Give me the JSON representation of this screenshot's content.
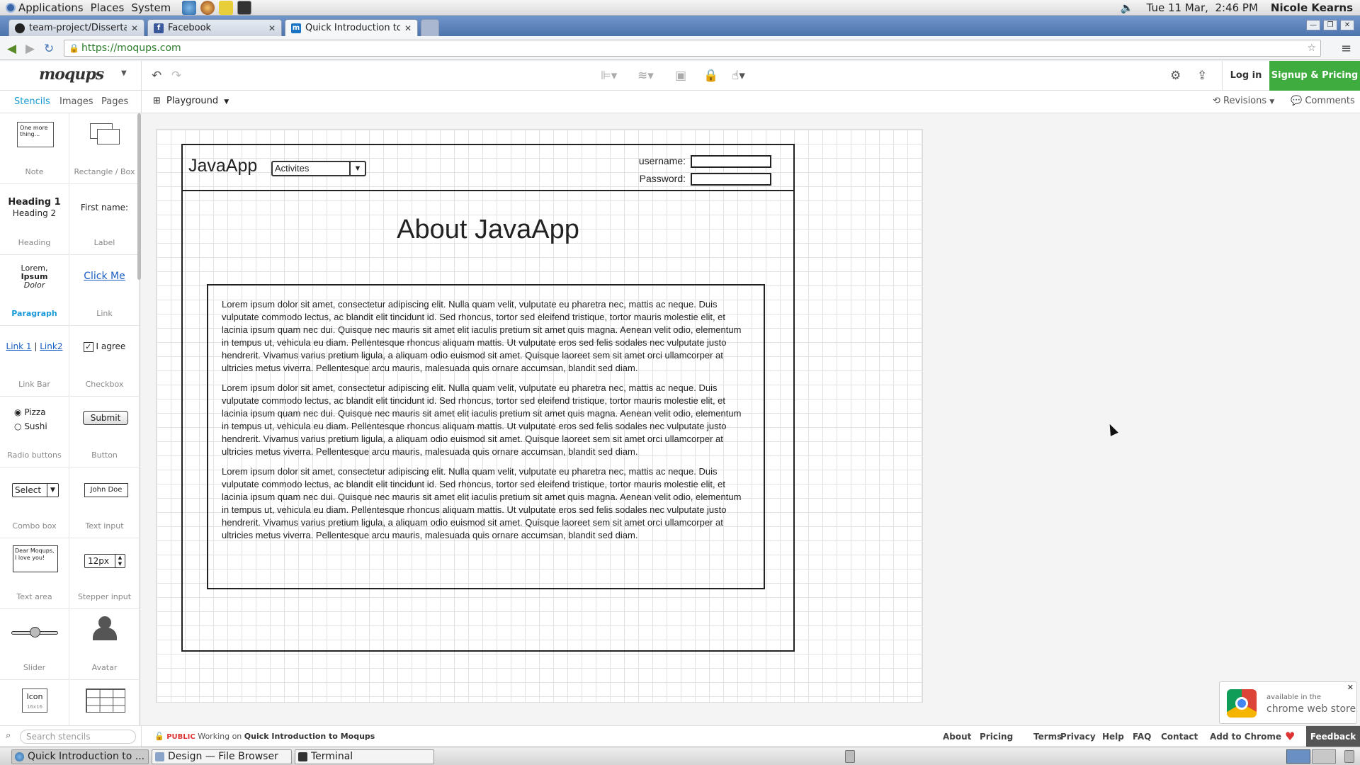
{
  "top_panel": {
    "menus": [
      "Applications",
      "Places",
      "System"
    ],
    "datetime": "Tue 11 Mar,  2:46 PM",
    "user": "Nicole Kearns"
  },
  "browser": {
    "tabs": [
      {
        "title": "team-project/Dissertatio",
        "icon": "github-icon"
      },
      {
        "title": "Facebook",
        "icon": "facebook-icon"
      },
      {
        "title": "Quick Introduction to M",
        "icon": "moqups-icon",
        "active": true
      }
    ],
    "url": "https://moqups.com"
  },
  "app": {
    "logo": "moqups",
    "login": "Log in",
    "signup": "Signup & Pricing",
    "side_tabs": [
      "Stencils",
      "Images",
      "Pages"
    ],
    "page_selector": "Playground",
    "revisions": "Revisions",
    "comments": "Comments"
  },
  "stencils": [
    {
      "label": "Note",
      "preview": "One more thing..."
    },
    {
      "label": "Rectangle / Box",
      "preview": ""
    },
    {
      "label": "Heading",
      "preview_h1": "Heading 1",
      "preview_h2": "Heading 2"
    },
    {
      "label": "Label",
      "preview": "First name:"
    },
    {
      "label": "Paragraph",
      "preview_1": "Lorem,",
      "preview_2": "Ipsum",
      "preview_3": "Dolor"
    },
    {
      "label": "Link",
      "preview": "Click Me"
    },
    {
      "label": "Link Bar",
      "preview_1": "Link 1",
      "preview_sep": "|",
      "preview_2": "Link2"
    },
    {
      "label": "Checkbox",
      "preview": "I agree"
    },
    {
      "label": "Radio buttons",
      "preview_1": "Pizza",
      "preview_2": "Sushi"
    },
    {
      "label": "Button",
      "preview": "Submit"
    },
    {
      "label": "Combo box",
      "preview": "Select"
    },
    {
      "label": "Text input",
      "preview": "John Doe"
    },
    {
      "label": "Text area",
      "preview": "Dear Moqups, I love you!"
    },
    {
      "label": "Stepper input",
      "preview": "12px"
    },
    {
      "label": "Slider",
      "preview": ""
    },
    {
      "label": "Avatar",
      "preview": ""
    },
    {
      "label": "",
      "preview": "Icon",
      "preview_sub": "16x16"
    },
    {
      "label": "",
      "preview": ""
    }
  ],
  "mockup": {
    "title": "JavaApp",
    "combo": "Activites",
    "username_label": "username:",
    "password_label": "Password:",
    "heading": "About JavaApp",
    "paragraphs": [
      "Lorem ipsum dolor sit amet, consectetur adipiscing elit. Nulla quam velit, vulputate eu pharetra nec, mattis ac neque. Duis vulputate commodo lectus, ac blandit elit tincidunt id. Sed rhoncus, tortor sed eleifend tristique, tortor mauris molestie elit, et lacinia ipsum quam nec dui. Quisque nec mauris sit amet elit iaculis pretium sit amet quis magna. Aenean velit odio, elementum in tempus ut, vehicula eu diam. Pellentesque rhoncus aliquam mattis. Ut vulputate eros sed felis sodales nec vulputate justo hendrerit. Vivamus varius pretium ligula, a aliquam odio euismod sit amet. Quisque laoreet sem sit amet orci ullamcorper at ultricies metus viverra. Pellentesque arcu mauris, malesuada quis ornare accumsan, blandit sed diam.",
      "Lorem ipsum dolor sit amet, consectetur adipiscing elit. Nulla quam velit, vulputate eu pharetra nec, mattis ac neque. Duis vulputate commodo lectus, ac blandit elit tincidunt id. Sed rhoncus, tortor sed eleifend tristique, tortor mauris molestie elit, et lacinia ipsum quam nec dui. Quisque nec mauris sit amet elit iaculis pretium sit amet quis magna. Aenean velit odio, elementum in tempus ut, vehicula eu diam. Pellentesque rhoncus aliquam mattis. Ut vulputate eros sed felis sodales nec vulputate justo hendrerit. Vivamus varius pretium ligula, a aliquam odio euismod sit amet. Quisque laoreet sem sit amet orci ullamcorper at ultricies metus viverra. Pellentesque arcu mauris, malesuada quis ornare accumsan, blandit sed diam.",
      "Lorem ipsum dolor sit amet, consectetur adipiscing elit. Nulla quam velit, vulputate eu pharetra nec, mattis ac neque. Duis vulputate commodo lectus, ac blandit elit tincidunt id. Sed rhoncus, tortor sed eleifend tristique, tortor mauris molestie elit, et lacinia ipsum quam nec dui. Quisque nec mauris sit amet elit iaculis pretium sit amet quis magna. Aenean velit odio, elementum in tempus ut, vehicula eu diam. Pellentesque rhoncus aliquam mattis. Ut vulputate eros sed felis sodales nec vulputate justo hendrerit. Vivamus varius pretium ligula, a aliquam odio euismod sit amet. Quisque laoreet sem sit amet orci ullamcorper at ultricies metus viverra. Pellentesque arcu mauris, malesuada quis ornare accumsan, blandit sed diam."
    ]
  },
  "status": {
    "search_placeholder": "Search stencils",
    "public": "PUBLIC",
    "working_on": "Working on",
    "doc_name": "Quick Introduction to Moqups",
    "footer_links": [
      "About",
      "Pricing",
      "Terms",
      "Privacy",
      "Help",
      "FAQ",
      "Contact",
      "Add to Chrome"
    ],
    "feedback": "Feedback"
  },
  "chrome_store": {
    "line1": "available in the",
    "line2": "chrome web store"
  },
  "taskbar": {
    "tasks": [
      "Quick Introduction to ...",
      "Design — File Browser",
      "Terminal"
    ]
  },
  "colors": {
    "accent_green": "#3fac3f",
    "stencil_active": "#1a9ad6"
  }
}
